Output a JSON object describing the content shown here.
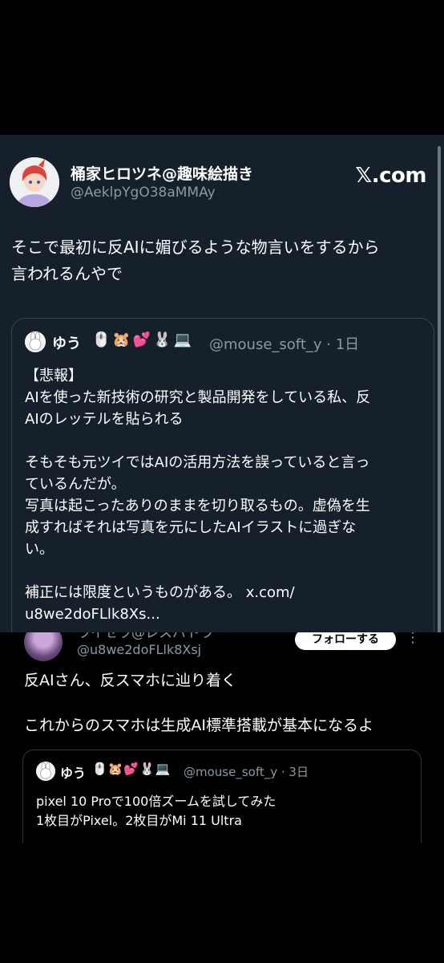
{
  "post": {
    "author_name": "桶家ヒロツネ@趣味絵描き",
    "author_handle": "@AeklpYgO38aMMAy",
    "brand": "𝕏.com",
    "text_lines": [
      "そこで最初に反AIに媚びるような物言いをするから",
      "言われるんやで"
    ]
  },
  "quoted": {
    "name": "ゆう",
    "emojis": "🖱️🐹💕🐰💻",
    "handle_time": "@mouse_soft_y · 1日",
    "body_lines": [
      "【悲報】",
      "AIを使った新技術の研究と製品開発をしている私、反",
      "AIのレッテルを貼られる",
      "",
      "そもそも元ツイではAIの活用方法を誤っていると言っ",
      "ているんだが。",
      "写真は起こったありのままを切り取るもの。虚偽を生",
      "成すればそれは写真を元にしたAIイラストに過ぎな",
      "い。",
      "",
      "補正には限度というものがある。 x.com/",
      "u8we2doFLlk8Xs..."
    ]
  },
  "embedded": {
    "name": "ライセラ@レスバトラー",
    "handle": "@u8we2doFLlk8Xsj",
    "follow_label": "フォローする",
    "more": "⋮",
    "text_lines": [
      "反AIさん、反スマホに辿り着く",
      "",
      "これからのスマホは生成AI標準搭載が基本になるよ"
    ],
    "quote": {
      "name": "ゆう",
      "emojis": "🖱️🐹💕🐰💻",
      "handle_time": "@mouse_soft_y · 3日",
      "body_lines": [
        "pixel 10 Proで100倍ズームを試してみた",
        "1枚目がPixel。2枚目がMi 11 Ultra"
      ]
    }
  },
  "colors": {
    "card_bg": "#15202b",
    "text": "#ffffff",
    "muted": "#8b98a5",
    "border": "#38444d"
  }
}
